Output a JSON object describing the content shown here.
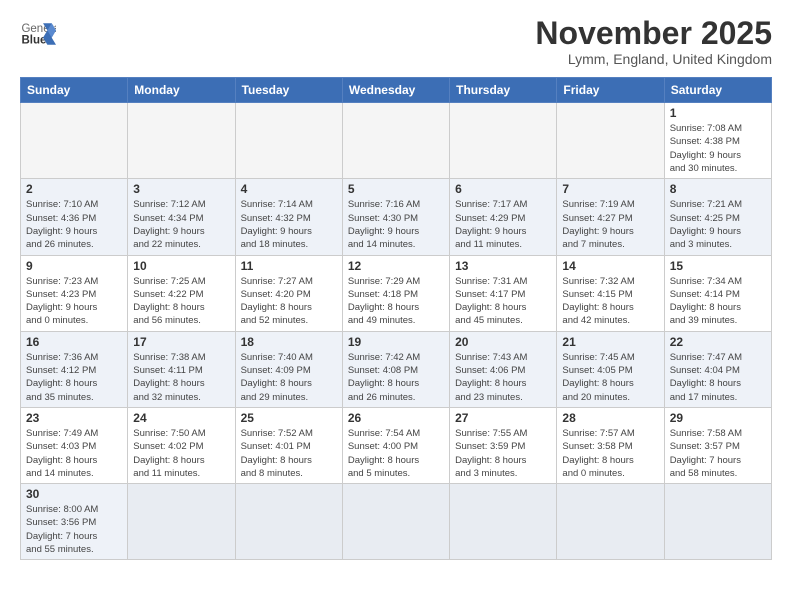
{
  "logo": {
    "text_general": "General",
    "text_blue": "Blue"
  },
  "header": {
    "month": "November 2025",
    "location": "Lymm, England, United Kingdom"
  },
  "weekdays": [
    "Sunday",
    "Monday",
    "Tuesday",
    "Wednesday",
    "Thursday",
    "Friday",
    "Saturday"
  ],
  "weeks": [
    [
      {
        "day": "",
        "info": ""
      },
      {
        "day": "",
        "info": ""
      },
      {
        "day": "",
        "info": ""
      },
      {
        "day": "",
        "info": ""
      },
      {
        "day": "",
        "info": ""
      },
      {
        "day": "",
        "info": ""
      },
      {
        "day": "1",
        "info": "Sunrise: 7:08 AM\nSunset: 4:38 PM\nDaylight: 9 hours\nand 30 minutes."
      }
    ],
    [
      {
        "day": "2",
        "info": "Sunrise: 7:10 AM\nSunset: 4:36 PM\nDaylight: 9 hours\nand 26 minutes."
      },
      {
        "day": "3",
        "info": "Sunrise: 7:12 AM\nSunset: 4:34 PM\nDaylight: 9 hours\nand 22 minutes."
      },
      {
        "day": "4",
        "info": "Sunrise: 7:14 AM\nSunset: 4:32 PM\nDaylight: 9 hours\nand 18 minutes."
      },
      {
        "day": "5",
        "info": "Sunrise: 7:16 AM\nSunset: 4:30 PM\nDaylight: 9 hours\nand 14 minutes."
      },
      {
        "day": "6",
        "info": "Sunrise: 7:17 AM\nSunset: 4:29 PM\nDaylight: 9 hours\nand 11 minutes."
      },
      {
        "day": "7",
        "info": "Sunrise: 7:19 AM\nSunset: 4:27 PM\nDaylight: 9 hours\nand 7 minutes."
      },
      {
        "day": "8",
        "info": "Sunrise: 7:21 AM\nSunset: 4:25 PM\nDaylight: 9 hours\nand 3 minutes."
      }
    ],
    [
      {
        "day": "9",
        "info": "Sunrise: 7:23 AM\nSunset: 4:23 PM\nDaylight: 9 hours\nand 0 minutes."
      },
      {
        "day": "10",
        "info": "Sunrise: 7:25 AM\nSunset: 4:22 PM\nDaylight: 8 hours\nand 56 minutes."
      },
      {
        "day": "11",
        "info": "Sunrise: 7:27 AM\nSunset: 4:20 PM\nDaylight: 8 hours\nand 52 minutes."
      },
      {
        "day": "12",
        "info": "Sunrise: 7:29 AM\nSunset: 4:18 PM\nDaylight: 8 hours\nand 49 minutes."
      },
      {
        "day": "13",
        "info": "Sunrise: 7:31 AM\nSunset: 4:17 PM\nDaylight: 8 hours\nand 45 minutes."
      },
      {
        "day": "14",
        "info": "Sunrise: 7:32 AM\nSunset: 4:15 PM\nDaylight: 8 hours\nand 42 minutes."
      },
      {
        "day": "15",
        "info": "Sunrise: 7:34 AM\nSunset: 4:14 PM\nDaylight: 8 hours\nand 39 minutes."
      }
    ],
    [
      {
        "day": "16",
        "info": "Sunrise: 7:36 AM\nSunset: 4:12 PM\nDaylight: 8 hours\nand 35 minutes."
      },
      {
        "day": "17",
        "info": "Sunrise: 7:38 AM\nSunset: 4:11 PM\nDaylight: 8 hours\nand 32 minutes."
      },
      {
        "day": "18",
        "info": "Sunrise: 7:40 AM\nSunset: 4:09 PM\nDaylight: 8 hours\nand 29 minutes."
      },
      {
        "day": "19",
        "info": "Sunrise: 7:42 AM\nSunset: 4:08 PM\nDaylight: 8 hours\nand 26 minutes."
      },
      {
        "day": "20",
        "info": "Sunrise: 7:43 AM\nSunset: 4:06 PM\nDaylight: 8 hours\nand 23 minutes."
      },
      {
        "day": "21",
        "info": "Sunrise: 7:45 AM\nSunset: 4:05 PM\nDaylight: 8 hours\nand 20 minutes."
      },
      {
        "day": "22",
        "info": "Sunrise: 7:47 AM\nSunset: 4:04 PM\nDaylight: 8 hours\nand 17 minutes."
      }
    ],
    [
      {
        "day": "23",
        "info": "Sunrise: 7:49 AM\nSunset: 4:03 PM\nDaylight: 8 hours\nand 14 minutes."
      },
      {
        "day": "24",
        "info": "Sunrise: 7:50 AM\nSunset: 4:02 PM\nDaylight: 8 hours\nand 11 minutes."
      },
      {
        "day": "25",
        "info": "Sunrise: 7:52 AM\nSunset: 4:01 PM\nDaylight: 8 hours\nand 8 minutes."
      },
      {
        "day": "26",
        "info": "Sunrise: 7:54 AM\nSunset: 4:00 PM\nDaylight: 8 hours\nand 5 minutes."
      },
      {
        "day": "27",
        "info": "Sunrise: 7:55 AM\nSunset: 3:59 PM\nDaylight: 8 hours\nand 3 minutes."
      },
      {
        "day": "28",
        "info": "Sunrise: 7:57 AM\nSunset: 3:58 PM\nDaylight: 8 hours\nand 0 minutes."
      },
      {
        "day": "29",
        "info": "Sunrise: 7:58 AM\nSunset: 3:57 PM\nDaylight: 7 hours\nand 58 minutes."
      }
    ],
    [
      {
        "day": "30",
        "info": "Sunrise: 8:00 AM\nSunset: 3:56 PM\nDaylight: 7 hours\nand 55 minutes."
      },
      {
        "day": "",
        "info": ""
      },
      {
        "day": "",
        "info": ""
      },
      {
        "day": "",
        "info": ""
      },
      {
        "day": "",
        "info": ""
      },
      {
        "day": "",
        "info": ""
      },
      {
        "day": "",
        "info": ""
      }
    ]
  ]
}
